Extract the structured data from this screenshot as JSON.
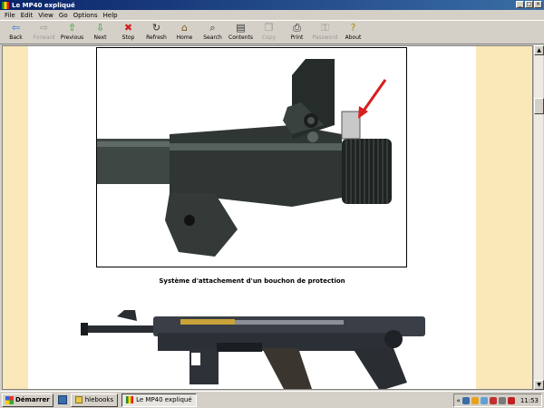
{
  "window": {
    "title": "Le MP40 expliqué",
    "controls": [
      "_",
      "□",
      "×"
    ]
  },
  "menu": [
    "File",
    "Edit",
    "View",
    "Go",
    "Options",
    "Help"
  ],
  "toolbar": [
    {
      "label": "Back",
      "icon": "back-arrow-icon",
      "glyph": "⇦",
      "color": "#2a7ad4",
      "enabled": true
    },
    {
      "label": "Forward",
      "icon": "forward-arrow-icon",
      "glyph": "⇨",
      "color": "#9a9a9a",
      "enabled": false
    },
    {
      "label": "Previous",
      "icon": "up-arrow-icon",
      "glyph": "⇧",
      "color": "#2aa02a",
      "enabled": true
    },
    {
      "label": "Next",
      "icon": "down-arrow-icon",
      "glyph": "⇩",
      "color": "#2aa02a",
      "enabled": true
    },
    {
      "label": "Stop",
      "icon": "stop-icon",
      "glyph": "✖",
      "color": "#d41e1e",
      "enabled": true
    },
    {
      "label": "Refresh",
      "icon": "refresh-icon",
      "glyph": "↻",
      "color": "#333333",
      "enabled": true
    },
    {
      "label": "Home",
      "icon": "home-icon",
      "glyph": "⌂",
      "color": "#7a5a20",
      "enabled": true
    },
    {
      "label": "Search",
      "icon": "search-icon",
      "glyph": "⌕",
      "color": "#333333",
      "enabled": true
    },
    {
      "label": "Contents",
      "icon": "contents-icon",
      "glyph": "▤",
      "color": "#333333",
      "enabled": true
    },
    {
      "label": "Copy",
      "icon": "copy-icon",
      "glyph": "❐",
      "color": "#9a9a9a",
      "enabled": false
    },
    {
      "label": "Print",
      "icon": "print-icon",
      "glyph": "⎙",
      "color": "#333333",
      "enabled": true
    },
    {
      "label": "Password",
      "icon": "password-icon",
      "glyph": "⚿",
      "color": "#9a9a9a",
      "enabled": false
    },
    {
      "label": "About",
      "icon": "about-icon",
      "glyph": "?",
      "color": "#b08a10",
      "enabled": true
    }
  ],
  "content": {
    "caption": "Système d'attachement d'un bouchon de protection",
    "page_bg": "#fbe8b8"
  },
  "scrollbar": {
    "up": "▲",
    "down": "▼"
  },
  "taskbar": {
    "start_label": "Démarrer",
    "tasks": [
      {
        "label": "hlebooks",
        "active": false
      },
      {
        "label": "Le MP40 expliqué",
        "active": true
      }
    ],
    "tray_prefix": "«",
    "clock": "11:53"
  }
}
